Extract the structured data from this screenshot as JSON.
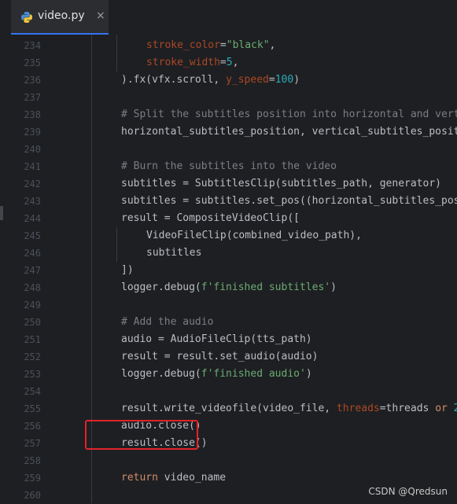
{
  "tab": {
    "title": "video.py",
    "close_glyph": "×",
    "icon": "python-icon"
  },
  "watermark": "CSDN @Qredsun",
  "colors": {
    "highlight_box": "#e0242a",
    "tab_accent": "#3574f0"
  },
  "lines": [
    {
      "num": "234",
      "indent": 2,
      "tokens": [
        {
          "t": "stroke_color",
          "c": "t-param"
        },
        {
          "t": "=",
          "c": "t-txt"
        },
        {
          "t": "\"black\"",
          "c": "t-str"
        },
        {
          "t": ",",
          "c": "t-txt"
        }
      ]
    },
    {
      "num": "235",
      "indent": 2,
      "tokens": [
        {
          "t": "stroke_width",
          "c": "t-param"
        },
        {
          "t": "=",
          "c": "t-txt"
        },
        {
          "t": "5",
          "c": "t-num"
        },
        {
          "t": ",",
          "c": "t-txt"
        }
      ]
    },
    {
      "num": "236",
      "indent": 1,
      "tokens": [
        {
          "t": ").fx(vfx.",
          "c": "t-txt"
        },
        {
          "t": "scroll",
          "c": "t-txt"
        },
        {
          "t": ", ",
          "c": "t-txt"
        },
        {
          "t": "y_speed",
          "c": "t-param"
        },
        {
          "t": "=",
          "c": "t-txt"
        },
        {
          "t": "100",
          "c": "t-num"
        },
        {
          "t": ")",
          "c": "t-txt"
        }
      ]
    },
    {
      "num": "237",
      "indent": 0,
      "tokens": []
    },
    {
      "num": "238",
      "indent": 1,
      "tokens": [
        {
          "t": "# Split the subtitles position into horizontal and vertica",
          "c": "t-cm"
        }
      ]
    },
    {
      "num": "239",
      "indent": 1,
      "tokens": [
        {
          "t": "horizontal_subtitles_position, vertical_subtitles_position",
          "c": "t-txt"
        }
      ]
    },
    {
      "num": "240",
      "indent": 0,
      "tokens": []
    },
    {
      "num": "241",
      "indent": 1,
      "tokens": [
        {
          "t": "# Burn the subtitles into the video",
          "c": "t-cm"
        }
      ]
    },
    {
      "num": "242",
      "indent": 1,
      "tokens": [
        {
          "t": "subtitles = SubtitlesClip(subtitles_path, generator)",
          "c": "t-txt"
        }
      ]
    },
    {
      "num": "243",
      "indent": 1,
      "tokens": [
        {
          "t": "subtitles = subtitles.",
          "c": "t-txt"
        },
        {
          "t": "set_pos",
          "c": "t-txt"
        },
        {
          "t": "((horizontal_subtitles_positi",
          "c": "t-txt"
        }
      ]
    },
    {
      "num": "244",
      "indent": 1,
      "tokens": [
        {
          "t": "result = CompositeVideoClip([",
          "c": "t-txt"
        }
      ]
    },
    {
      "num": "245",
      "indent": 2,
      "tokens": [
        {
          "t": "VideoFileClip(combined_video_path),",
          "c": "t-txt"
        }
      ]
    },
    {
      "num": "246",
      "indent": 2,
      "tokens": [
        {
          "t": "subtitles",
          "c": "t-txt"
        }
      ]
    },
    {
      "num": "247",
      "indent": 1,
      "tokens": [
        {
          "t": "])",
          "c": "t-txt"
        }
      ]
    },
    {
      "num": "248",
      "indent": 1,
      "tokens": [
        {
          "t": "logger.debug(",
          "c": "t-txt"
        },
        {
          "t": "f'finished subtitles'",
          "c": "t-str"
        },
        {
          "t": ")",
          "c": "t-txt"
        }
      ]
    },
    {
      "num": "249",
      "indent": 0,
      "tokens": []
    },
    {
      "num": "250",
      "indent": 1,
      "tokens": [
        {
          "t": "# Add the audio",
          "c": "t-cm"
        }
      ]
    },
    {
      "num": "251",
      "indent": 1,
      "tokens": [
        {
          "t": "audio = AudioFileClip(tts_path)",
          "c": "t-txt"
        }
      ]
    },
    {
      "num": "252",
      "indent": 1,
      "tokens": [
        {
          "t": "result = result.set_audio(audio)",
          "c": "t-txt"
        }
      ]
    },
    {
      "num": "253",
      "indent": 1,
      "tokens": [
        {
          "t": "logger.debug(",
          "c": "t-txt"
        },
        {
          "t": "f'finished audio'",
          "c": "t-str"
        },
        {
          "t": ")",
          "c": "t-txt"
        }
      ]
    },
    {
      "num": "254",
      "indent": 0,
      "tokens": []
    },
    {
      "num": "255",
      "indent": 1,
      "tokens": [
        {
          "t": "result.write_videofile(video_file, ",
          "c": "t-txt"
        },
        {
          "t": "threads",
          "c": "t-param"
        },
        {
          "t": "=threads ",
          "c": "t-txt"
        },
        {
          "t": "or",
          "c": "t-kw"
        },
        {
          "t": " ",
          "c": "t-txt"
        },
        {
          "t": "2",
          "c": "t-num"
        },
        {
          "t": ")",
          "c": "t-txt"
        }
      ]
    },
    {
      "num": "256",
      "indent": 1,
      "tokens": [
        {
          "t": "audio.close()",
          "c": "t-txt"
        }
      ]
    },
    {
      "num": "257",
      "indent": 1,
      "tokens": [
        {
          "t": "result.close()",
          "c": "t-txt"
        }
      ]
    },
    {
      "num": "258",
      "indent": 0,
      "tokens": []
    },
    {
      "num": "259",
      "indent": 1,
      "tokens": [
        {
          "t": "return",
          "c": "t-kw"
        },
        {
          "t": " video_name",
          "c": "t-txt"
        }
      ]
    },
    {
      "num": "260",
      "indent": 0,
      "tokens": []
    }
  ]
}
